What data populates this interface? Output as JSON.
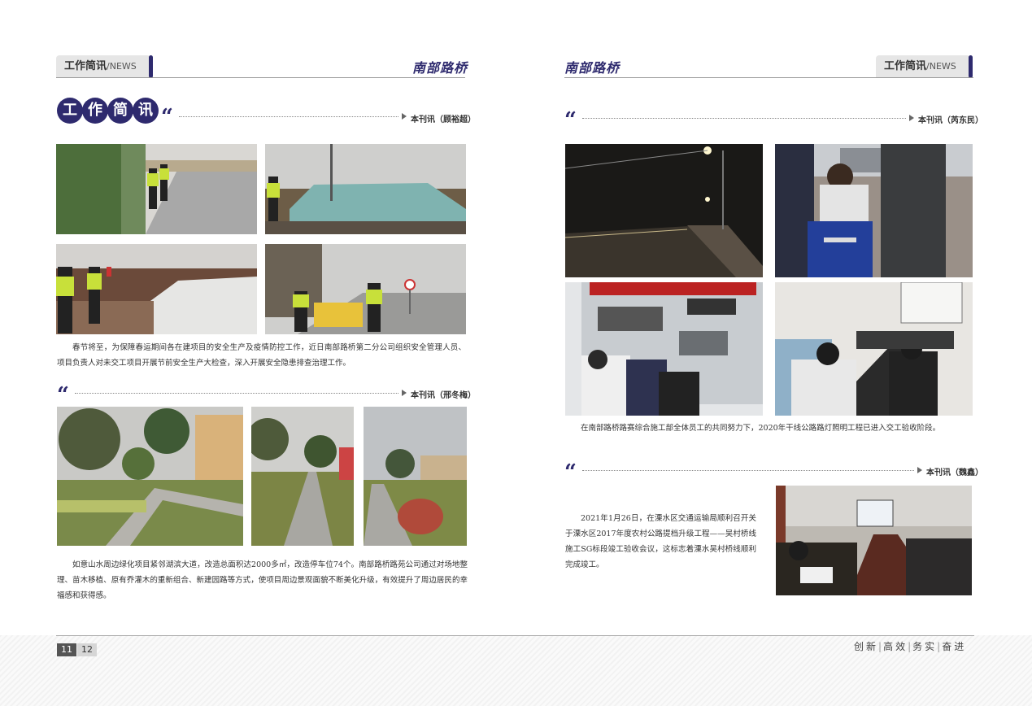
{
  "header": {
    "section_cn": "工作简讯",
    "section_en": "NEWS",
    "separator": "/",
    "brand": "南部路桥"
  },
  "left": {
    "title_chars": [
      "工",
      "作",
      "简",
      "讯"
    ],
    "article1": {
      "byline": "本刊讯（顾裕超）",
      "text": "春节将至，为保障春运期间各在建项目的安全生产及疫情防控工作，近日南部路桥第二分公司组织安全管理人员、项目负责人对未交工项目开展节前安全生产大检查，深入开展安全隐患排查治理工作。"
    },
    "article2": {
      "byline": "本刊讯（邢冬梅）",
      "text": "如意山水周边绿化项目紧邻湖滨大道，改造总面积达2000多㎡，改造停车位74个。南部路桥路苑公司通过对场地整理、苗木移植、原有乔灌木的重新组合、新建园路等方式，使项目周边景观面貌不断美化升级，有效提升了周边居民的幸福感和获得感。"
    }
  },
  "right": {
    "article3": {
      "byline": "本刊讯（芮东民）",
      "text": "在南部路桥路赛综合施工部全体员工的共同努力下，2020年干线公路路灯照明工程已进入交工验收阶段。"
    },
    "article4": {
      "byline": "本刊讯（魏鑫）",
      "text": "2021年1月26日，在溧水区交通运输局顺利召开关于溧水区2017年度农村公路提档升级工程——吴村桥线施工SG标段竣工验收会议，这标志着溧水吴村桥线顺利完成竣工。"
    }
  },
  "footer": {
    "page_left": "11",
    "page_right": "12",
    "slogan": [
      "创新",
      "高效",
      "务实",
      "奋进"
    ]
  },
  "colors": {
    "accent": "#2e2a6e",
    "tab_bg": "#e6e6e6"
  }
}
